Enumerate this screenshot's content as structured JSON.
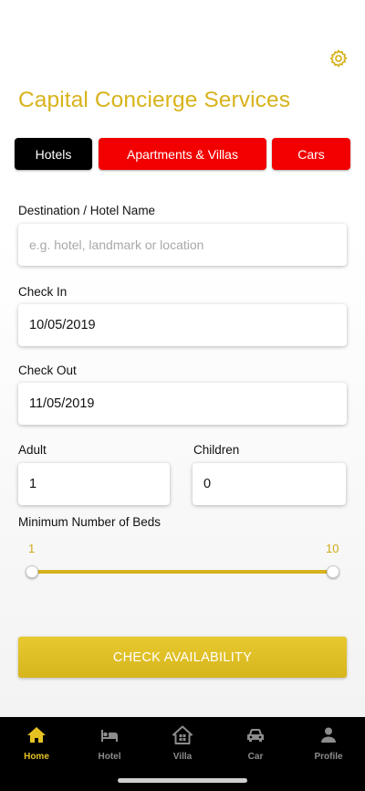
{
  "header": {
    "settings_icon": "gear-icon",
    "title": "Capital Concierge Services"
  },
  "tabs": [
    {
      "label": "Hotels",
      "active": true
    },
    {
      "label": "Apartments & Villas",
      "active": false
    },
    {
      "label": "Cars",
      "active": false
    }
  ],
  "form": {
    "destination": {
      "label": "Destination / Hotel Name",
      "value": "",
      "placeholder": "e.g. hotel, landmark or location"
    },
    "check_in": {
      "label": "Check In",
      "value": "10/05/2019"
    },
    "check_out": {
      "label": "Check Out",
      "value": "11/05/2019"
    },
    "adult": {
      "label": "Adult",
      "value": "1"
    },
    "children": {
      "label": "Children",
      "value": "0"
    },
    "beds": {
      "label": "Minimum Number of Beds",
      "min_label": "1",
      "max_label": "10",
      "selected_min": 1,
      "selected_max": 10
    }
  },
  "cta": {
    "label": "CHECK AVAILABILITY"
  },
  "bottom_nav": [
    {
      "label": "Home",
      "icon": "home-icon",
      "active": true
    },
    {
      "label": "Hotel",
      "icon": "bed-icon",
      "active": false
    },
    {
      "label": "Villa",
      "icon": "villa-icon",
      "active": false
    },
    {
      "label": "Car",
      "icon": "car-icon",
      "active": false
    },
    {
      "label": "Profile",
      "icon": "person-icon",
      "active": false
    }
  ],
  "colors": {
    "brand_gold": "#d8b31b",
    "tab_inactive": "#f20000",
    "tab_active": "#000000",
    "nav_active": "#e5c221",
    "nav_inactive": "#8c8c8c"
  }
}
